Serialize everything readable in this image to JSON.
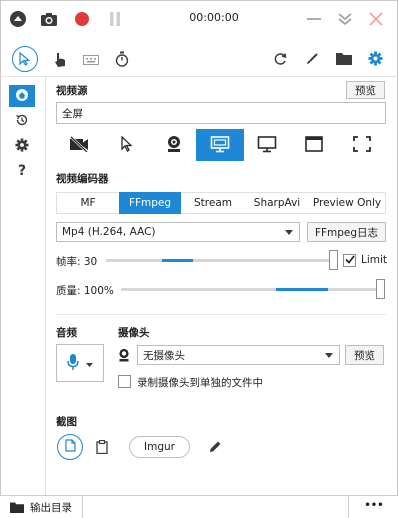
{
  "titlebar": {
    "timer": "00:00:00"
  },
  "sections": {
    "video_source": "视频源",
    "video_encoder": "视频编码器",
    "audio": "音频",
    "webcam": "摄像头",
    "screenshot": "截图"
  },
  "source": {
    "preview_label": "预览",
    "value": "全屏"
  },
  "encoder": {
    "tabs": [
      "MF",
      "FFmpeg",
      "Stream",
      "SharpAvi",
      "Preview Only"
    ],
    "selected_tab": "FFmpeg",
    "format": "Mp4 (H.264, AAC)",
    "log_label": "FFmpeg日志"
  },
  "framerate": {
    "label": "帧率: 30",
    "value": 30,
    "limit_label": "Limit",
    "limit_checked": true
  },
  "quality": {
    "label": "质量: 100%",
    "value": 100
  },
  "webcam": {
    "selected": "无摄像头",
    "preview_label": "预览",
    "separate_file_label": "录制摄像头到单独的文件中",
    "separate_file_checked": false
  },
  "screenshot": {
    "imgur_label": "Imgur"
  },
  "statusbar": {
    "output_folder_label": "输出目录",
    "more_label": "•••"
  },
  "colors": {
    "accent": "#1e88d6",
    "record_red": "#e03a3a"
  }
}
